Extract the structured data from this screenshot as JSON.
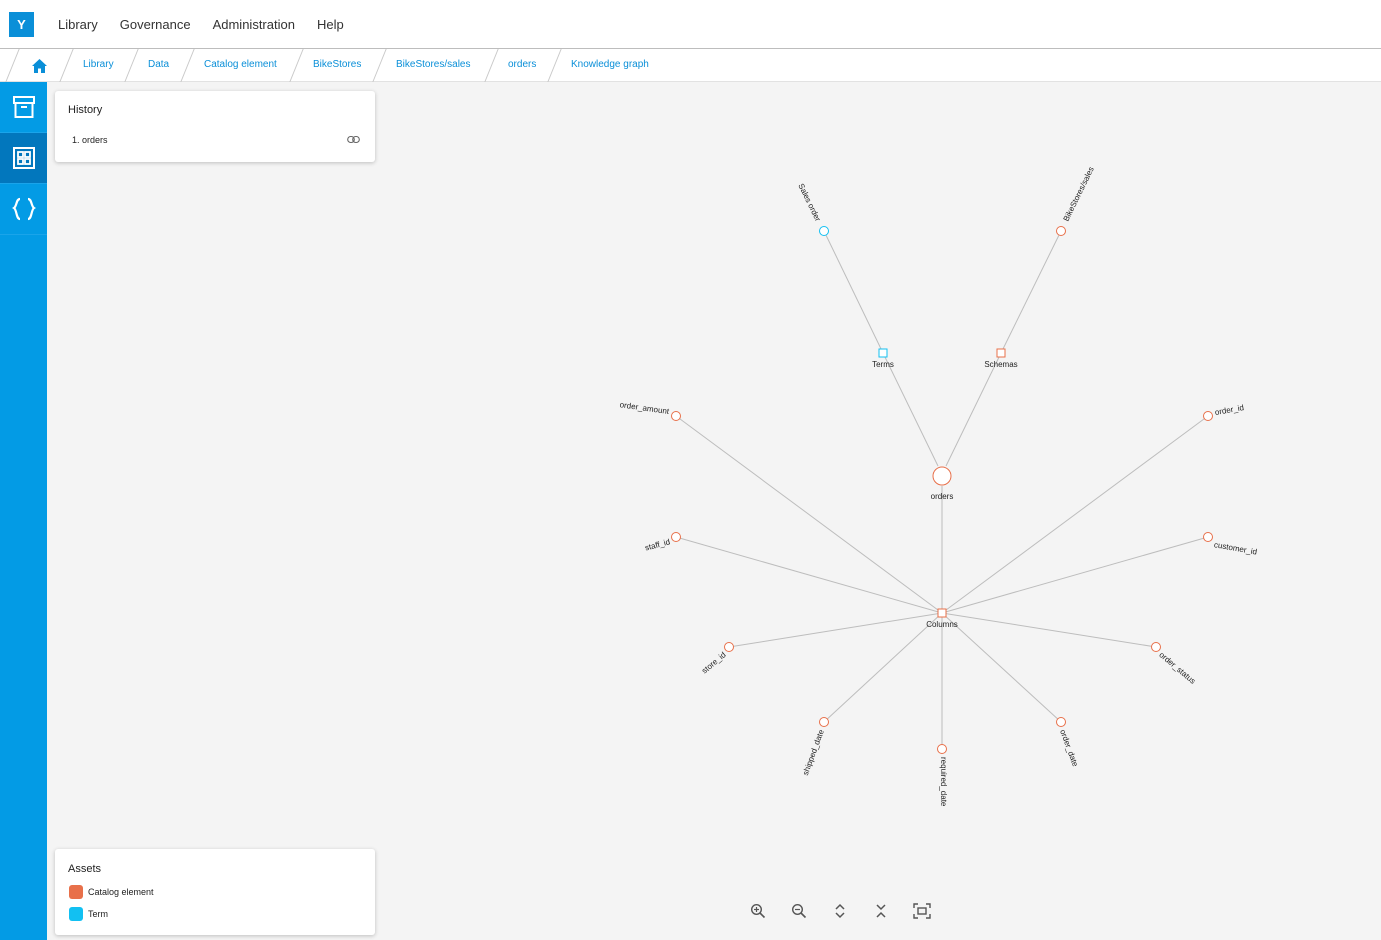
{
  "app": {
    "logo_letter": "Y"
  },
  "menu": [
    "Library",
    "Governance",
    "Administration",
    "Help"
  ],
  "breadcrumb": [
    "Library",
    "Data",
    "Catalog element",
    "BikeStores",
    "BikeStores/sales",
    "orders",
    "Knowledge graph"
  ],
  "rail": {
    "active": "grid"
  },
  "history": {
    "title": "History",
    "items": [
      "1. orders"
    ]
  },
  "assets": {
    "title": "Assets",
    "items": [
      {
        "label": "Catalog element",
        "color": "#e8704a"
      },
      {
        "label": "Term",
        "color": "#12c0f2"
      }
    ]
  },
  "graph": {
    "center": "orders",
    "groups": {
      "terms": "Terms",
      "schemas": "Schemas",
      "columns": "Columns"
    },
    "term_items": [
      "Sales order"
    ],
    "schema_items": [
      "BikeStores/sales"
    ],
    "column_items": [
      "order_amount",
      "order_id",
      "staff_id",
      "customer_id",
      "store_id",
      "order_status",
      "shipped_date",
      "required_date",
      "order_date"
    ],
    "colors": {
      "catalog": "#e8704a",
      "term": "#12c0f2",
      "edge": "#bdbdbd"
    }
  }
}
